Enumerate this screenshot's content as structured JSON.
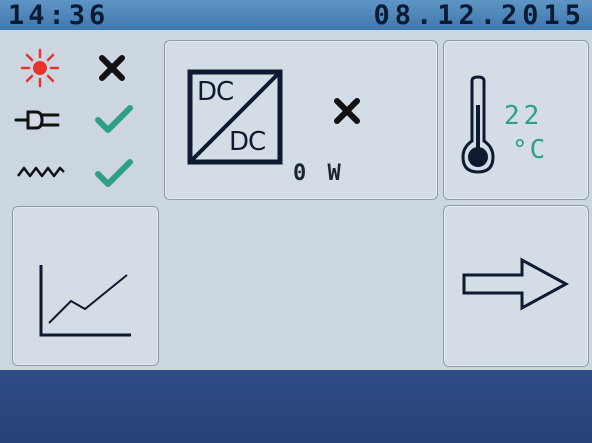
{
  "header": {
    "time": "14:36",
    "date": "08.12.2015"
  },
  "status": {
    "items": [
      {
        "icon": "sun-icon",
        "state": "error",
        "state_icon": "cross-icon"
      },
      {
        "icon": "plug-icon",
        "state": "ok",
        "state_icon": "check-icon"
      },
      {
        "icon": "wave-icon",
        "state": "ok",
        "state_icon": "check-icon"
      }
    ]
  },
  "converter": {
    "top_label": "DC",
    "bottom_label": "DC",
    "state_icon": "cross-icon",
    "power": "0 W"
  },
  "temperature": {
    "value": "22",
    "unit": "°C"
  },
  "colors": {
    "header": "#4a84b9",
    "background": "#cbd6e0",
    "footer": "#2b4780",
    "ok": "#2f9f87",
    "error": "#111111",
    "sun": "#e8322b"
  }
}
